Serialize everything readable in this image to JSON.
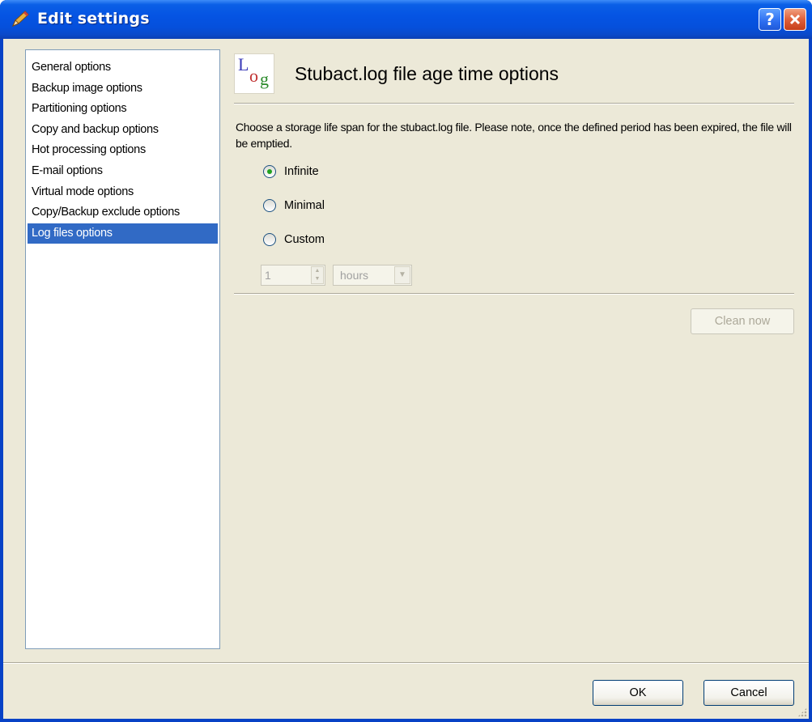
{
  "window": {
    "title": "Edit settings"
  },
  "sidebar": {
    "items": [
      {
        "label": "General options",
        "selected": false
      },
      {
        "label": "Backup image options",
        "selected": false
      },
      {
        "label": "Partitioning options",
        "selected": false
      },
      {
        "label": "Copy and backup options",
        "selected": false
      },
      {
        "label": "Hot processing options",
        "selected": false
      },
      {
        "label": "E-mail options",
        "selected": false
      },
      {
        "label": "Virtual mode options",
        "selected": false
      },
      {
        "label": "Copy/Backup exclude options",
        "selected": false
      },
      {
        "label": "Log files options",
        "selected": true
      }
    ]
  },
  "header": {
    "icon_text": "Log",
    "title": "Stubact.log file age time options"
  },
  "content": {
    "description": "Choose a storage life span for the stubact.log file. Please note, once the defined period has been expired, the file will be emptied.",
    "options": [
      {
        "label": "Infinite",
        "checked": true
      },
      {
        "label": "Minimal",
        "checked": false
      },
      {
        "label": "Custom",
        "checked": false
      }
    ],
    "custom_value": "1",
    "custom_unit": "hours",
    "clean_now_label": "Clean now"
  },
  "footer": {
    "ok_label": "OK",
    "cancel_label": "Cancel"
  },
  "colors": {
    "titlebar": "#0554e3",
    "selection": "#316ac5",
    "dialog_bg": "#ece9d8"
  }
}
